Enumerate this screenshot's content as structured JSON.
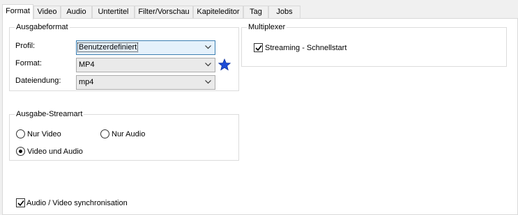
{
  "tabs": [
    "Format",
    "Video",
    "Audio",
    "Untertitel",
    "Filter/Vorschau",
    "Kapiteleditor",
    "Tag",
    "Jobs"
  ],
  "output_format": {
    "title": "Ausgabeformat",
    "profile_label": "Profil:",
    "profile_value": "Benutzerdefiniert",
    "format_label": "Format:",
    "format_value": "MP4",
    "extension_label": "Dateiendung:",
    "extension_value": "mp4",
    "star_icon": "star-icon",
    "star_color": "#1e4cd6"
  },
  "multiplexer": {
    "title": "Multiplexer",
    "fast_start_label": "Streaming - Schnellstart",
    "fast_start_checked": true
  },
  "stream_type": {
    "title": "Ausgabe-Streamart",
    "video_only_label": "Nur Video",
    "audio_only_label": "Nur Audio",
    "video_audio_label": "Video und Audio",
    "selected": "Video und Audio"
  },
  "sync": {
    "label": "Audio / Video synchronisation",
    "checked": true
  }
}
